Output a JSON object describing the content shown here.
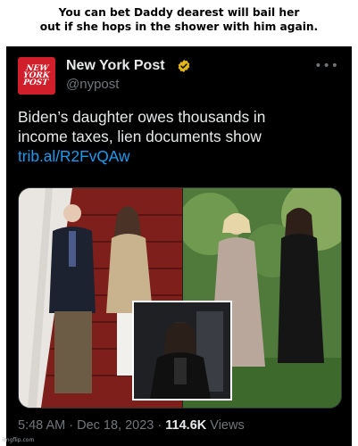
{
  "caption": {
    "line1": "You can bet Daddy dearest will bail her",
    "line2": "out if she hops in the shower with him again."
  },
  "tweet": {
    "avatar_text": [
      "NEW",
      "YORK",
      "POST"
    ],
    "display_name": "New York Post",
    "verified_icon": "gold-verified-badge",
    "handle": "@nypost",
    "more_icon": "more-options",
    "body_line1": "Biden’s daughter owes thousands in",
    "body_line2": "income taxes, lien documents show",
    "link": "trib.al/R2FvQAw",
    "time": "5:48 AM",
    "date": "Dec 18, 2023",
    "views_count": "114.6K",
    "views_label": "Views",
    "separator": "·"
  },
  "watermark": "imgflip.com",
  "colors": {
    "background": "#000000",
    "text": "#e7e9ea",
    "muted": "#71767b",
    "link": "#1d9bf0",
    "brand_red": "#d01f2a",
    "badge_gold": "#e2b719"
  }
}
